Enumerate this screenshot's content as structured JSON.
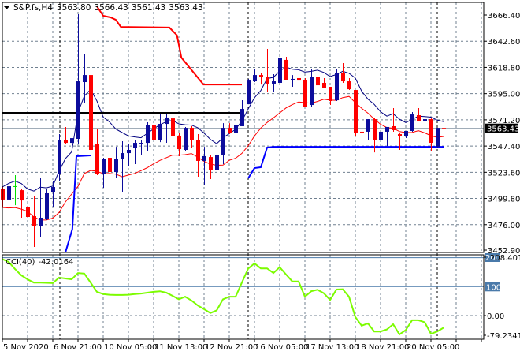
{
  "chart_data": {
    "type": "candlestick",
    "title": "S&P.fs,H4",
    "header_values": [
      "3563.80",
      "3566.43",
      "3561.43",
      "3563.43"
    ],
    "ylim": [
      3452.9,
      3666.4
    ],
    "y_ticks": [
      "3666.40",
      "3642.60",
      "3618.80",
      "3595.00",
      "3571.20",
      "3547.40",
      "3523.60",
      "3499.80",
      "3476.00",
      "3452.90"
    ],
    "y_tick_values": [
      3666.4,
      3642.6,
      3618.8,
      3595.0,
      3571.2,
      3547.4,
      3523.6,
      3499.8,
      3476.0,
      3452.9
    ],
    "x_ticks": [
      {
        "label": "5 Nov 2020",
        "index": 0
      },
      {
        "label": "6 Nov 21:00",
        "index": 8
      },
      {
        "label": "10 Nov 05:00",
        "index": 16
      },
      {
        "label": "11 Nov 13:00",
        "index": 24
      },
      {
        "label": "12 Nov 21:00",
        "index": 32
      },
      {
        "label": "16 Nov 05:00",
        "index": 40
      },
      {
        "label": "17 Nov 13:00",
        "index": 48
      },
      {
        "label": "18 Nov 21:00",
        "index": 56
      },
      {
        "label": "20 Nov 05:00",
        "index": 64
      }
    ],
    "period_separators": [
      9.1,
      39,
      69
    ],
    "current_price": "3563.43",
    "current_price_value": 3563.43,
    "candles_ohlc": [
      [
        3508.1,
        3510.2,
        3491.6,
        3498.8
      ],
      [
        3498.8,
        3521.7,
        3488.7,
        3510.9
      ],
      [
        3510.9,
        3521.0,
        3493.7,
        3511.0
      ],
      [
        3507.3,
        3508.1,
        3482.3,
        3498.0
      ],
      [
        3491.6,
        3495.9,
        3475.8,
        3483.0
      ],
      [
        3483.7,
        3501.6,
        3455.8,
        3474.4
      ],
      [
        3474.4,
        3518.8,
        3465.1,
        3482.3
      ],
      [
        3481.6,
        3508.1,
        3480.1,
        3504.5
      ],
      [
        3505.2,
        3515.2,
        3491.6,
        3510.2
      ],
      [
        3521.7,
        3558.2,
        3515.2,
        3552.5
      ],
      [
        3553.2,
        3564.7,
        3548.9,
        3550.3
      ],
      [
        3550.3,
        3557.5,
        3543.9,
        3554.6
      ],
      [
        3553.9,
        3667.1,
        3548.9,
        3606.2
      ],
      [
        3605.5,
        3630.6,
        3586.9,
        3611.9
      ],
      [
        3611.9,
        3613.4,
        3540.3,
        3543.9
      ],
      [
        3548.9,
        3562.5,
        3521.0,
        3521.7
      ],
      [
        3521.7,
        3536.7,
        3509.5,
        3536.0
      ],
      [
        3536.7,
        3558.2,
        3523.8,
        3523.8
      ],
      [
        3523.8,
        3546.7,
        3518.8,
        3536.0
      ],
      [
        3535.3,
        3551.8,
        3505.9,
        3541.0
      ],
      [
        3541.0,
        3548.9,
        3529.6,
        3543.9
      ],
      [
        3546.0,
        3553.2,
        3531.0,
        3550.3
      ],
      [
        3550.0,
        3553.2,
        3538.9,
        3550.3
      ],
      [
        3550.3,
        3569.0,
        3542.5,
        3566.1
      ],
      [
        3566.1,
        3573.3,
        3551.0,
        3552.5
      ],
      [
        3552.5,
        3576.1,
        3551.0,
        3567.5
      ],
      [
        3567.5,
        3576.1,
        3550.3,
        3573.3
      ],
      [
        3572.5,
        3574.0,
        3552.5,
        3556.1
      ],
      [
        3556.8,
        3559.6,
        3538.2,
        3544.6
      ],
      [
        3543.9,
        3564.7,
        3542.5,
        3563.9
      ],
      [
        3563.9,
        3565.4,
        3546.0,
        3553.2
      ],
      [
        3553.2,
        3558.2,
        3519.5,
        3533.9
      ],
      [
        3533.9,
        3546.7,
        3512.4,
        3538.2
      ],
      [
        3537.4,
        3539.6,
        3517.4,
        3525.3
      ],
      [
        3525.3,
        3539.6,
        3523.8,
        3539.6
      ],
      [
        3538.9,
        3568.2,
        3531.0,
        3563.9
      ],
      [
        3563.9,
        3568.2,
        3558.2,
        3559.6
      ],
      [
        3559.6,
        3572.5,
        3546.7,
        3566.1
      ],
      [
        3565.4,
        3589.0,
        3565.4,
        3581.1
      ],
      [
        3585.4,
        3608.4,
        3585.4,
        3606.9
      ],
      [
        3606.2,
        3617.0,
        3605.5,
        3611.9
      ],
      [
        3611.9,
        3614.1,
        3603.3,
        3610.5
      ],
      [
        3610.5,
        3635.6,
        3596.2,
        3604.1
      ],
      [
        3604.1,
        3612.7,
        3596.2,
        3606.2
      ],
      [
        3604.8,
        3629.9,
        3602.6,
        3627.7
      ],
      [
        3625.6,
        3628.4,
        3606.9,
        3607.6
      ],
      [
        3608.0,
        3611.9,
        3601.2,
        3608.4
      ],
      [
        3609.1,
        3615.5,
        3601.2,
        3606.9
      ],
      [
        3607.6,
        3609.1,
        3583.3,
        3583.3
      ],
      [
        3584.7,
        3617.0,
        3583.3,
        3609.8
      ],
      [
        3610.5,
        3619.1,
        3596.9,
        3602.6
      ],
      [
        3604.8,
        3609.1,
        3600.5,
        3600.5
      ],
      [
        3601.2,
        3601.2,
        3584.7,
        3588.3
      ],
      [
        3589.0,
        3617.0,
        3588.3,
        3614.1
      ],
      [
        3614.1,
        3622.7,
        3604.8,
        3606.2
      ],
      [
        3606.2,
        3609.1,
        3598.3,
        3599.0
      ],
      [
        3598.3,
        3598.3,
        3556.1,
        3559.6
      ],
      [
        3560.4,
        3567.5,
        3553.2,
        3560.0
      ],
      [
        3560.4,
        3571.8,
        3553.2,
        3571.8
      ],
      [
        3571.8,
        3573.3,
        3541.7,
        3552.5
      ],
      [
        3552.5,
        3561.8,
        3541.7,
        3560.4
      ],
      [
        3560.4,
        3564.7,
        3547.5,
        3564.7
      ],
      [
        3565.4,
        3581.9,
        3560.4,
        3561.8
      ],
      [
        3558.2,
        3559.6,
        3543.9,
        3556.1
      ],
      [
        3556.1,
        3561.1,
        3554.6,
        3561.1
      ],
      [
        3561.1,
        3578.3,
        3560.4,
        3576.1
      ],
      [
        3575.4,
        3581.9,
        3570.4,
        3570.4
      ],
      [
        3570.4,
        3573.3,
        3548.2,
        3571.8
      ],
      [
        3571.8,
        3572.5,
        3542.5,
        3550.3
      ],
      [
        3546.7,
        3563.9,
        3546.0,
        3563.9
      ],
      [
        3563.8,
        3566.43,
        3561.43,
        3563.43
      ]
    ],
    "resistance_line": {
      "price": 3577.6,
      "from_index": 0,
      "to_index": 38
    },
    "upper_channel": [
      [
        15,
        3674.3
      ],
      [
        16,
        3665.7
      ],
      [
        17.2,
        3664.2
      ],
      [
        18,
        3662.0
      ],
      [
        18.8,
        3655.6
      ],
      [
        26.5,
        3655.0
      ],
      [
        27.7,
        3648.0
      ],
      [
        28.4,
        3627.7
      ],
      [
        31.9,
        3603.3
      ],
      [
        38,
        3603.3
      ]
    ],
    "lower_channel": [
      [
        [
          10,
          3450.7
        ],
        [
          11.1,
          3472.0
        ],
        [
          11.75,
          3538.2
        ],
        [
          14,
          3538.9
        ]
      ],
      [
        [
          39,
          3518.1
        ],
        [
          40,
          3527.4
        ],
        [
          41,
          3528.1
        ],
        [
          42,
          3546.0
        ],
        [
          43,
          3546.7
        ],
        [
          70,
          3546.7
        ]
      ]
    ],
    "indicator": {
      "name": "CCI(40)",
      "value": "-42.0164",
      "axis_labels": [
        "208.4014",
        "100",
        "0.00",
        "-79.2341"
      ],
      "level_box_labels": [
        "200",
        "100"
      ],
      "ylim": [
        -79.2341,
        208.4014
      ],
      "levels": [
        200,
        100,
        0
      ],
      "values": [
        195,
        185,
        161,
        139,
        125,
        114,
        114,
        113,
        112,
        131,
        128,
        125,
        147,
        145,
        114,
        82,
        74,
        72,
        71,
        71,
        72,
        74,
        76,
        79,
        82,
        84,
        79,
        68,
        56,
        65,
        52,
        35,
        22,
        9,
        18,
        56,
        65,
        65,
        114,
        162,
        180,
        163,
        163,
        147,
        167,
        142,
        118,
        118,
        65,
        84,
        89,
        77,
        54,
        90,
        91,
        65,
        -5,
        -35,
        -27,
        -55,
        -55,
        -48,
        -30,
        -65,
        -50,
        -16,
        -16,
        -23,
        -63,
        -55,
        -42.0164
      ]
    },
    "colors": {
      "bull": "#0c0c9c",
      "bear": "#ff0000",
      "doji_first": "#00dd00",
      "fast_line": "#000080",
      "slow_line": "#ff0000",
      "upper_channel": "#ff0000",
      "lower_channel": "#0000ff",
      "cci": "#7cfc00",
      "level": "#4a7aaa",
      "grid": "#708090"
    }
  }
}
